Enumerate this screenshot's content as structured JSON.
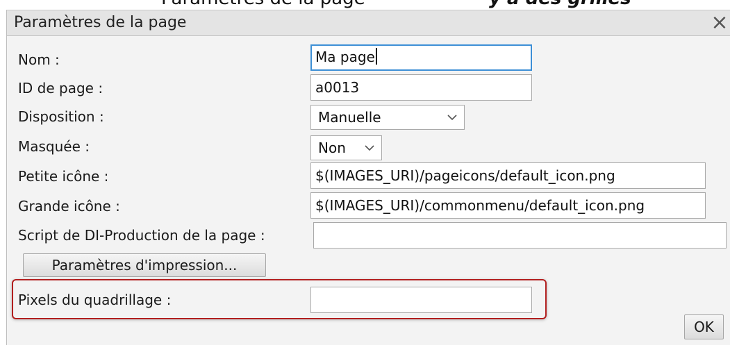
{
  "top_fragment": {
    "left_text": "Paramètres de la page",
    "right_text": "y a des grilles"
  },
  "dialog": {
    "title": "Paramètres de la page",
    "close_symbol": "×"
  },
  "fields": {
    "nom": {
      "label": "Nom :",
      "value": "Ma page"
    },
    "page_id": {
      "label": "ID de page :",
      "value": "a0013"
    },
    "disposition": {
      "label": "Disposition :",
      "selected": "Manuelle"
    },
    "masquee": {
      "label": "Masquée :",
      "selected": "Non"
    },
    "petite_icone": {
      "label": "Petite icône :",
      "value": "$(IMAGES_URI)/pageicons/default_icon.png"
    },
    "grande_icone": {
      "label": "Grande icône :",
      "value": "$(IMAGES_URI)/commonmenu/default_icon.png"
    },
    "script": {
      "label": "Script de DI-Production de la page :",
      "value": ""
    },
    "pixels": {
      "label": "Pixels du quadrillage :",
      "value": ""
    }
  },
  "buttons": {
    "print_settings": "Paramètres d'impression...",
    "ok": "OK"
  },
  "colors": {
    "highlight": "#b21f1f",
    "focus": "#3d8fd6"
  }
}
